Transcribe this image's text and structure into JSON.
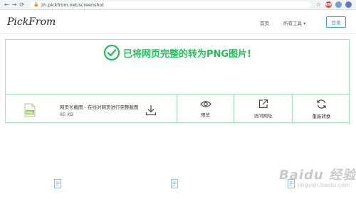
{
  "browser": {
    "url": "zh.pickfrom.net/screenshot",
    "ext_abp": "ABP"
  },
  "header": {
    "logo": "PickFrom",
    "nav_home": "首页",
    "nav_tools": "所有工具 ▾",
    "login": "登录"
  },
  "result": {
    "message": "已将网页完整的转为PNG图片!",
    "file_name": "网页长截图 - 在线对网页进行完整截图",
    "file_size": "85 KB",
    "file_badge": "PNG",
    "actions": {
      "preview": "预览",
      "visit": "访问网址",
      "reconvert": "重新转换"
    }
  },
  "watermark": {
    "brand": "Baidu 经验",
    "sub": "jingyan.baidu.com"
  },
  "colors": {
    "success_green": "#22c05a",
    "border_green": "#9ce7b5",
    "login_blue": "#3c9be5"
  }
}
